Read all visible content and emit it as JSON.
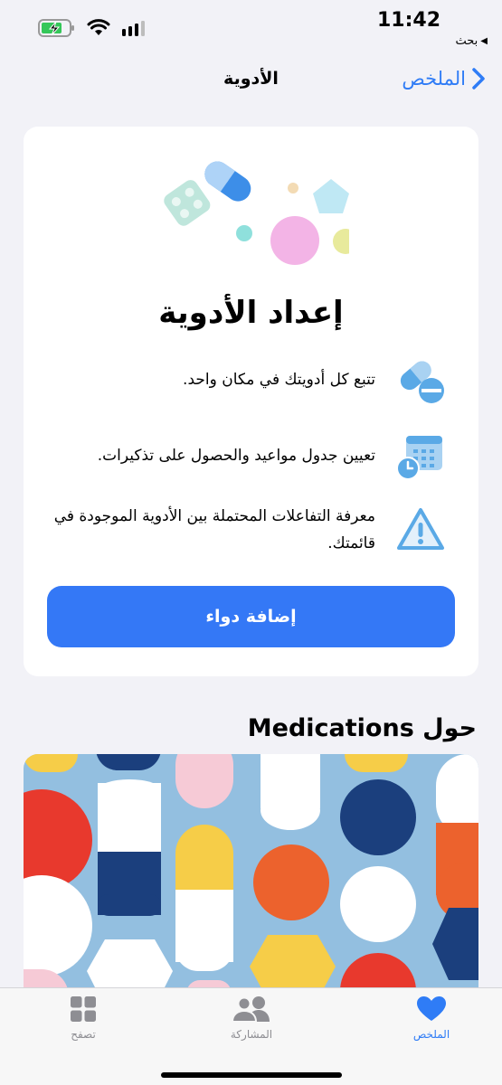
{
  "status_bar": {
    "time": "11:42",
    "back_app": "بحث",
    "battery_icon": "battery-charging-icon",
    "wifi_icon": "wifi-icon",
    "signal_icon": "cellular-signal-icon"
  },
  "nav": {
    "title": "الأدوية",
    "back_label": "الملخص",
    "back_icon": "chevron-right-icon"
  },
  "setup_card": {
    "title": "إعداد الأدوية",
    "features": [
      {
        "icon": "pills-icon",
        "text": "تتبع كل أدويتك في مكان واحد."
      },
      {
        "icon": "calendar-clock-icon",
        "text": "تعيين جدول مواعيد والحصول على تذكيرات."
      },
      {
        "icon": "warning-triangle-icon",
        "text": "معرفة التفاعلات المحتملة بين الأدوية الموجودة في قائمتك."
      }
    ],
    "add_button": "إضافة دواء"
  },
  "about": {
    "heading": "حول Medications"
  },
  "tab_bar": {
    "tabs": [
      {
        "label": "الملخص",
        "icon": "heart-icon",
        "active": true
      },
      {
        "label": "المشاركة",
        "icon": "people-icon",
        "active": false
      },
      {
        "label": "تصفح",
        "icon": "grid-icon",
        "active": false
      }
    ]
  },
  "colors": {
    "accent": "#2f7cf6",
    "button": "#3478f6",
    "background": "#f2f2f7",
    "icon_blue": "#5aa9e6"
  }
}
